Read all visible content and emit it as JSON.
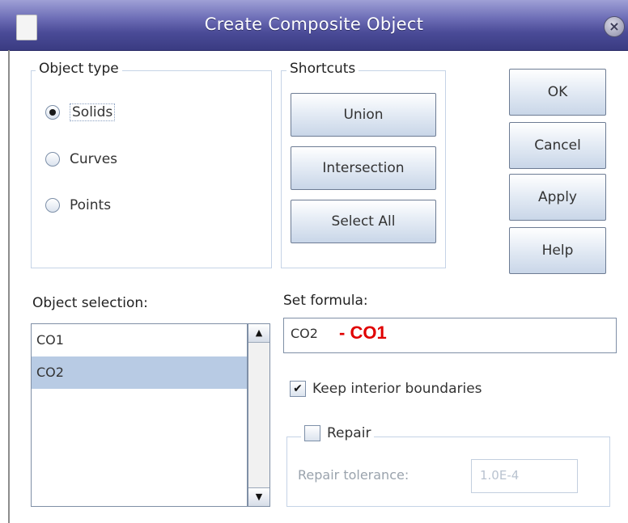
{
  "window": {
    "title": "Create Composite Object",
    "close_glyph": "×",
    "icon_name": "window-icon"
  },
  "object_type": {
    "legend": "Object type",
    "options": [
      {
        "label": "Solids",
        "checked": true
      },
      {
        "label": "Curves",
        "checked": false
      },
      {
        "label": "Points",
        "checked": false
      }
    ]
  },
  "shortcuts": {
    "legend": "Shortcuts",
    "buttons": [
      "Union",
      "Intersection",
      "Select All"
    ]
  },
  "actions": {
    "ok": "OK",
    "cancel": "Cancel",
    "apply": "Apply",
    "help": "Help"
  },
  "object_selection": {
    "label": "Object selection:",
    "items": [
      "CO1",
      "CO2"
    ],
    "selected_index": 1,
    "scroll_up_glyph": "▲",
    "scroll_down_glyph": "▼"
  },
  "formula": {
    "label": "Set formula:",
    "value": "CO2",
    "annotation": "- CO1"
  },
  "keep_interior": {
    "label": "Keep interior boundaries",
    "checked": true,
    "check_glyph": "✔"
  },
  "repair": {
    "legend": "Repair",
    "checked": false,
    "tolerance_label": "Repair tolerance:",
    "tolerance_value": "1.0E-4"
  },
  "colors": {
    "title_bar": "#4a4b97",
    "selection": "#b8cbe4",
    "annotation": "#e00000"
  }
}
